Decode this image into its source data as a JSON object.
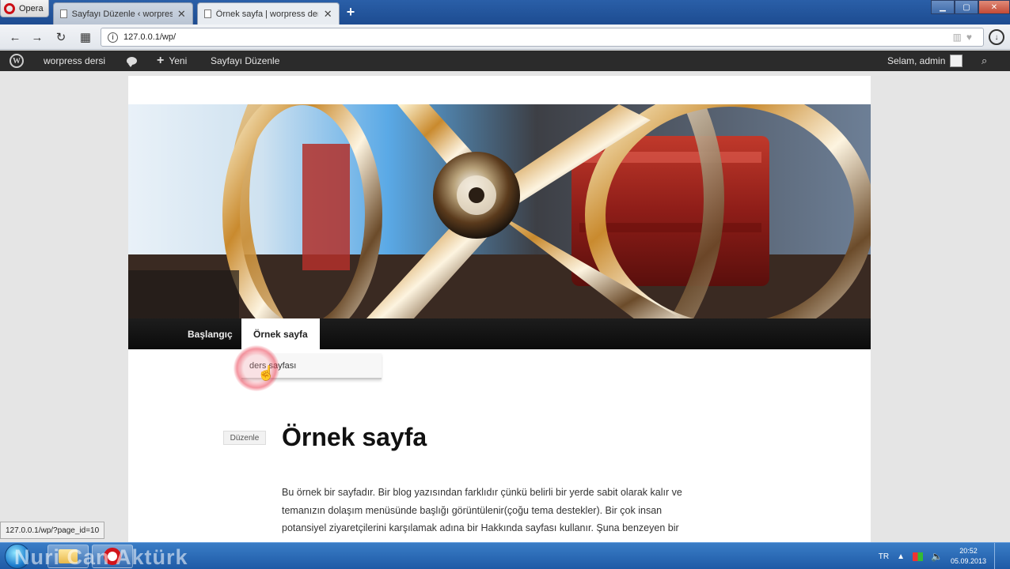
{
  "browser": {
    "menu_label": "Opera",
    "tabs": [
      {
        "title": "Sayfayı Düzenle ‹ worpress dersi",
        "active": false
      },
      {
        "title": "Örnek sayfa | worpress dersi",
        "active": true
      }
    ],
    "new_tab_symbol": "+",
    "url": "127.0.0.1/wp/",
    "status_url": "127.0.0.1/wp/?page_id=10"
  },
  "adminbar": {
    "site_name": "worpress dersi",
    "new_label": "Yeni",
    "edit_page_label": "Sayfayı Düzenle",
    "greeting": "Selam, admin"
  },
  "site": {
    "nav": [
      {
        "label": "Başlangıç",
        "active": false
      },
      {
        "label": "Örnek sayfa",
        "active": true
      }
    ],
    "submenu_item": "ders sayfası"
  },
  "post": {
    "edit_label": "Düzenle",
    "title": "Örnek sayfa",
    "lines": [
      "Bu örnek bir sayfadır. Bir blog yazısından farklıdır çünkü belirli bir yerde sabit olarak kalır ve",
      "temanızın dolaşım menüsünde başlığı görüntülenir(çoğu tema destekler). Bir çok insan",
      "potansiyel ziyaretçilerini karşılamak adına bir Hakkında sayfası kullanır. Şuna benzeyen bir"
    ]
  },
  "taskbar": {
    "watermark": "Nuri Can Aktürk",
    "language": "TR",
    "time": "20:52",
    "date": "05.09.2013"
  },
  "colors": {
    "adminbar_bg": "#2b2b2b",
    "nav_bg": "#111111",
    "taskbar_blue": "#1e5aa6",
    "click_highlight": "#eb3c50"
  },
  "icons": {
    "wp_logo": "wordpress-logo-icon",
    "comments": "speech-bubble-icon",
    "search": "search-icon",
    "back": "back-arrow-icon",
    "forward": "forward-arrow-icon",
    "reload": "reload-icon",
    "speed_dial": "speed-dial-icon",
    "cursor": "pointer-hand-icon"
  }
}
